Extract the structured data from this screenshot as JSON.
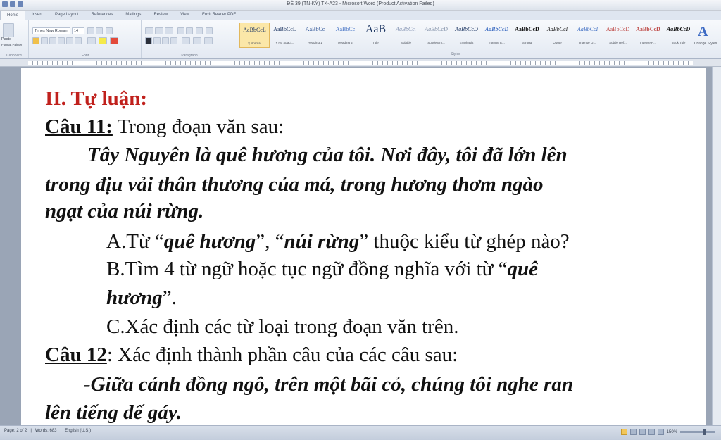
{
  "window": {
    "title": "ĐỀ 39 (TN-KỲ) TK-A23 - Microsoft Word (Product Activation Failed)"
  },
  "ribbon_tabs": [
    "Home",
    "Insert",
    "Page Layout",
    "References",
    "Mailings",
    "Review",
    "View",
    "Foxit Reader PDF"
  ],
  "ribbon": {
    "clipboard_label": "Clipboard",
    "paste_label": "Paste",
    "format_painter_label": "Format Painter",
    "font_label": "Font",
    "font_name": "Times New Roman",
    "font_size": "14",
    "paragraph_label": "Paragraph",
    "styles_label": "Styles",
    "change_styles_label": "Change Styles",
    "styles": [
      {
        "sample": "AaBbCcL",
        "name": "¶ Normal",
        "selected": true
      },
      {
        "sample": "AaBbCcL",
        "name": "¶ No Spaci...",
        "selected": false
      },
      {
        "sample": "AaBbCc",
        "name": "Heading 1",
        "selected": false
      },
      {
        "sample": "AaBbCc",
        "name": "Heading 2",
        "selected": false
      },
      {
        "sample": "AaB",
        "name": "Title",
        "selected": false
      },
      {
        "sample": "AaBbCc.",
        "name": "Subtitle",
        "selected": false
      },
      {
        "sample": "AaBbCcD",
        "name": "Subtle Em...",
        "selected": false
      },
      {
        "sample": "AaBbCcD",
        "name": "Emphasis",
        "selected": false
      },
      {
        "sample": "AaBbCcD",
        "name": "Intense E...",
        "selected": false
      },
      {
        "sample": "AaBbCcD",
        "name": "Strong",
        "selected": false
      },
      {
        "sample": "AaBbCcI",
        "name": "Quote",
        "selected": false
      },
      {
        "sample": "AaBbCcI",
        "name": "Intense Q...",
        "selected": false
      },
      {
        "sample": "AaBbCcD",
        "name": "Subtle Ref...",
        "selected": false
      },
      {
        "sample": "AaBbCcD",
        "name": "Intense R...",
        "selected": false
      },
      {
        "sample": "AaBbCcD",
        "name": "Book Title",
        "selected": false
      }
    ]
  },
  "document": {
    "heading": "II. Tự luận:",
    "q11_label": "Câu 11:",
    "q11_text": " Trong đoạn văn sau:",
    "passage": [
      "Tây Nguyên là quê hương của tôi. Nơi đây, tôi đã lớn lên",
      "trong địu vải thân thương của má, trong hương thơm ngào",
      "ngạt của núi rừng."
    ],
    "item_a": {
      "p1": "A.Từ “",
      "b1": "quê hương",
      "p2": "”, “",
      "b2": "núi rừng",
      "p3": "” thuộc kiểu từ ghép nào?"
    },
    "item_b": {
      "p1": "B.Tìm 4 từ ngữ hoặc tục ngữ đồng nghĩa với từ “",
      "b1": "quê",
      "b2": "hương",
      "p2": "”."
    },
    "item_c": "C.Xác định các từ loại trong đoạn văn trên.",
    "q12_label": "Câu 12",
    "q12_text": ":  Xác định thành phần câu của các câu sau:",
    "sentence": [
      "-Giữa cánh đồng ngô, trên một bãi cỏ, chúng tôi nghe ran",
      "lên tiếng dế gáy."
    ]
  },
  "status": {
    "page": "Page: 2 of 2",
    "words": "Words: 683",
    "language": "English (U.S.)",
    "zoom": "150%"
  },
  "colors": {
    "heading": "#c0201c",
    "page": "#ffffff",
    "workspace": "#9aa5b6"
  }
}
